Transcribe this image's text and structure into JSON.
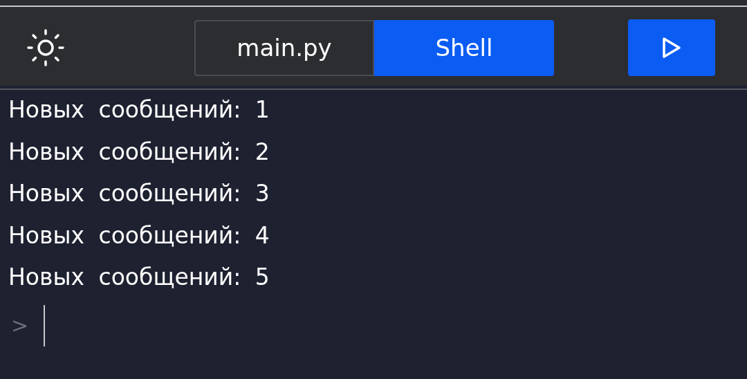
{
  "tabs": [
    {
      "label": "main.py",
      "selected": false
    },
    {
      "label": "Shell",
      "selected": true
    }
  ],
  "output": [
    "Новых сообщений: 1",
    "Новых сообщений: 2",
    "Новых сообщений: 3",
    "Новых сообщений: 4",
    "Новых сообщений: 5"
  ],
  "prompt": ">"
}
